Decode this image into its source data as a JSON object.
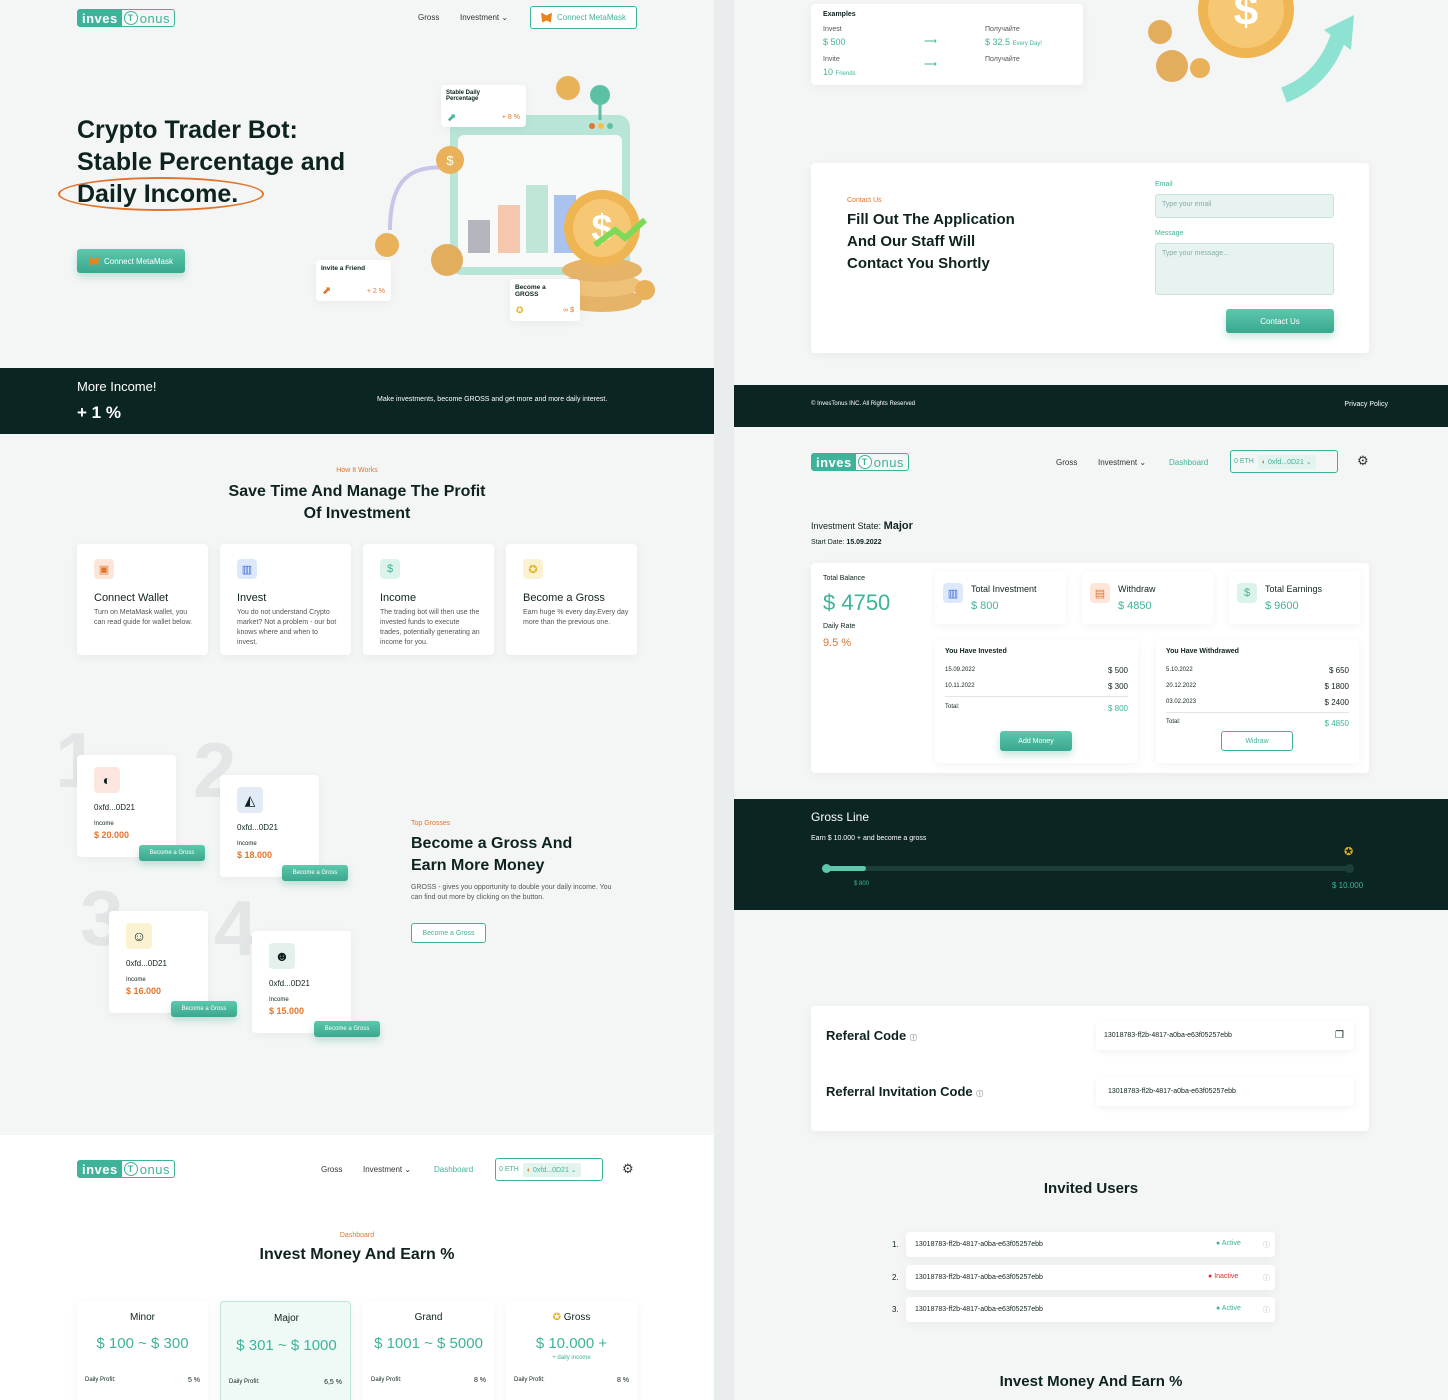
{
  "brand": {
    "part1": "inves",
    "part2": "T",
    "part3": "onus"
  },
  "nav": {
    "gross": "Gross",
    "investment": "Investment",
    "dashboard": "Dashboard",
    "connect": "Connect MetaMask"
  },
  "wallet": {
    "eth": "0 ETH",
    "address": "0xfd...0D21"
  },
  "hero": {
    "line1": "Crypto Trader Bot:",
    "line2": "Stable Percentage and",
    "line3": "Daily Income.",
    "cta": "Connect MetaMask",
    "stable_title": "Stable Daily Percentage",
    "stable_value": "+ 8 %",
    "invite_title": "Invite a Friend",
    "invite_value": "+ 2 %",
    "gross_title": "Become a GROSS",
    "gross_value": "∞ $"
  },
  "banner": {
    "title": "More Income!",
    "value": "+ 1 %",
    "text": "Make investments, become GROSS and get more and more daily interest."
  },
  "how": {
    "tag": "How It Works",
    "title1": "Save Time And Manage The Profit",
    "title2": "Of Investment",
    "cards": [
      {
        "title": "Connect Wallet",
        "text": "Turn on MetaMask wallet, you can read guide for wallet below."
      },
      {
        "title": "Invest",
        "text": "You do not understand Crypto market? Not a problem - our bot knows where and when to invest."
      },
      {
        "title": "Income",
        "text": "The trading bot will then use the invested funds to execute trades, potentially generating an income for you."
      },
      {
        "title": "Become a Gross",
        "text": "Earn huge % every day.Every day more than the previous one."
      }
    ]
  },
  "top": {
    "tag": "Top Grosses",
    "title1": "Become a Gross And",
    "title2": "Earn More Money",
    "text": "GROSS - gives you opportunity to double your daily income. You can find out more by clicking on the button.",
    "button": "Become a Gross",
    "ranks": [
      {
        "num": "1",
        "addr": "0xfd...0D21",
        "label": "Income",
        "value": "$ 20.000",
        "btn": "Become a Gross"
      },
      {
        "num": "2",
        "addr": "0xfd...0D21",
        "label": "Income",
        "value": "$ 18.000",
        "btn": "Become a Gross"
      },
      {
        "num": "3",
        "addr": "0xfd...0D21",
        "label": "Income",
        "value": "$ 16.000",
        "btn": "Become a Gross"
      },
      {
        "num": "4",
        "addr": "0xfd...0D21",
        "label": "Income",
        "value": "$ 15.000",
        "btn": "Become a Gross"
      }
    ]
  },
  "dashboard_intro": {
    "tag": "Dashboard",
    "title": "Invest Money And Earn %"
  },
  "plans": [
    {
      "name": "Minor",
      "range": "$ 100 ~ $ 300",
      "sub": "",
      "profit_label": "Daily Profit:",
      "profit": "5 %"
    },
    {
      "name": "Major",
      "range": "$ 301 ~ $ 1000",
      "sub": "",
      "profit_label": "Daily Profit:",
      "profit": "6,5 %"
    },
    {
      "name": "Grand",
      "range": "$ 1001 ~ $ 5000",
      "sub": "",
      "profit_label": "Daily Profit:",
      "profit": "8 %"
    },
    {
      "name": "Gross",
      "range": "$ 10.000 +",
      "sub": "+ daily income",
      "profit_label": "Daily Profit:",
      "profit": "8 %"
    }
  ],
  "examples": {
    "title": "Examples",
    "invest_label": "Invest",
    "invest_value": "$ 500",
    "get_label": "Получайте",
    "get_value": "$ 32.5",
    "get_sub": "Every Day!",
    "invite_label": "Invite",
    "invite_value": "10",
    "invite_sub": "Friends",
    "get2_label": "Получайте"
  },
  "contact": {
    "tag": "Contact Us",
    "line1": "Fill Out The Application",
    "line2": "And Our Staff Will",
    "line3": "Contact You Shortly",
    "email_label": "Email",
    "email_ph": "Type your email",
    "message_label": "Message",
    "message_ph": "Type your message...",
    "button": "Contact Us"
  },
  "footer": {
    "copy": "© InvesTonus INC. All Rights Reserved",
    "privacy": "Privacy Policy"
  },
  "state": {
    "label": "Investment State:",
    "value": "Major",
    "start_label": "Start Date:",
    "start_value": "15.09.2022"
  },
  "balance": {
    "label": "Total Balance",
    "value": "$ 4750",
    "rate_label": "Daily Rate",
    "rate_value": "9.5 %"
  },
  "stats": [
    {
      "label": "Total Investment",
      "value": "$ 800"
    },
    {
      "label": "Withdraw",
      "value": "$ 4850"
    },
    {
      "label": "Total Earnings",
      "value": "$ 9600"
    }
  ],
  "invested": {
    "title": "You Have Invested",
    "rows": [
      {
        "date": "15.09.2022",
        "amount": "$ 500"
      },
      {
        "date": "10.11.2022",
        "amount": "$ 300"
      }
    ],
    "total_label": "Total:",
    "total": "$ 800",
    "button": "Add Money"
  },
  "withdrawn": {
    "title": "You Have Withdrawed",
    "rows": [
      {
        "date": "5.10.2022",
        "amount": "$ 650"
      },
      {
        "date": "20.12.2022",
        "amount": "$ 1800"
      },
      {
        "date": "03.02.2023",
        "amount": "$ 2400"
      }
    ],
    "total_label": "Total:",
    "total": "$ 4850",
    "button": "Widraw"
  },
  "grossline": {
    "title": "Gross Line",
    "text": "Earn $ 10.000 + and become a gross",
    "current": "$ 800",
    "target": "$ 10.000",
    "progress": 0.08
  },
  "referral": {
    "code_label": "Referal Code",
    "code": "13018783-ff2b-4817-a0ba-e63f05257ebb",
    "inv_label": "Referral Invitation Code",
    "inv_code": "13018783-ff2b-4817-a0ba-e63f05257ebb"
  },
  "invited": {
    "title": "Invited Users",
    "users": [
      {
        "n": "1.",
        "id": "13018783-ff2b-4817-a0ba-e63f05257ebb",
        "status": "Active"
      },
      {
        "n": "2.",
        "id": "13018783-ff2b-4817-a0ba-e63f05257ebb",
        "status": "Inactive"
      },
      {
        "n": "3.",
        "id": "13018783-ff2b-4817-a0ba-e63f05257ebb",
        "status": "Active"
      }
    ]
  },
  "bottom_title": "Invest Money And Earn %",
  "colors": {
    "accent": "#3fb39a",
    "orange": "#e0752e",
    "dark": "#0b2622",
    "inactive": "#d9302c"
  }
}
